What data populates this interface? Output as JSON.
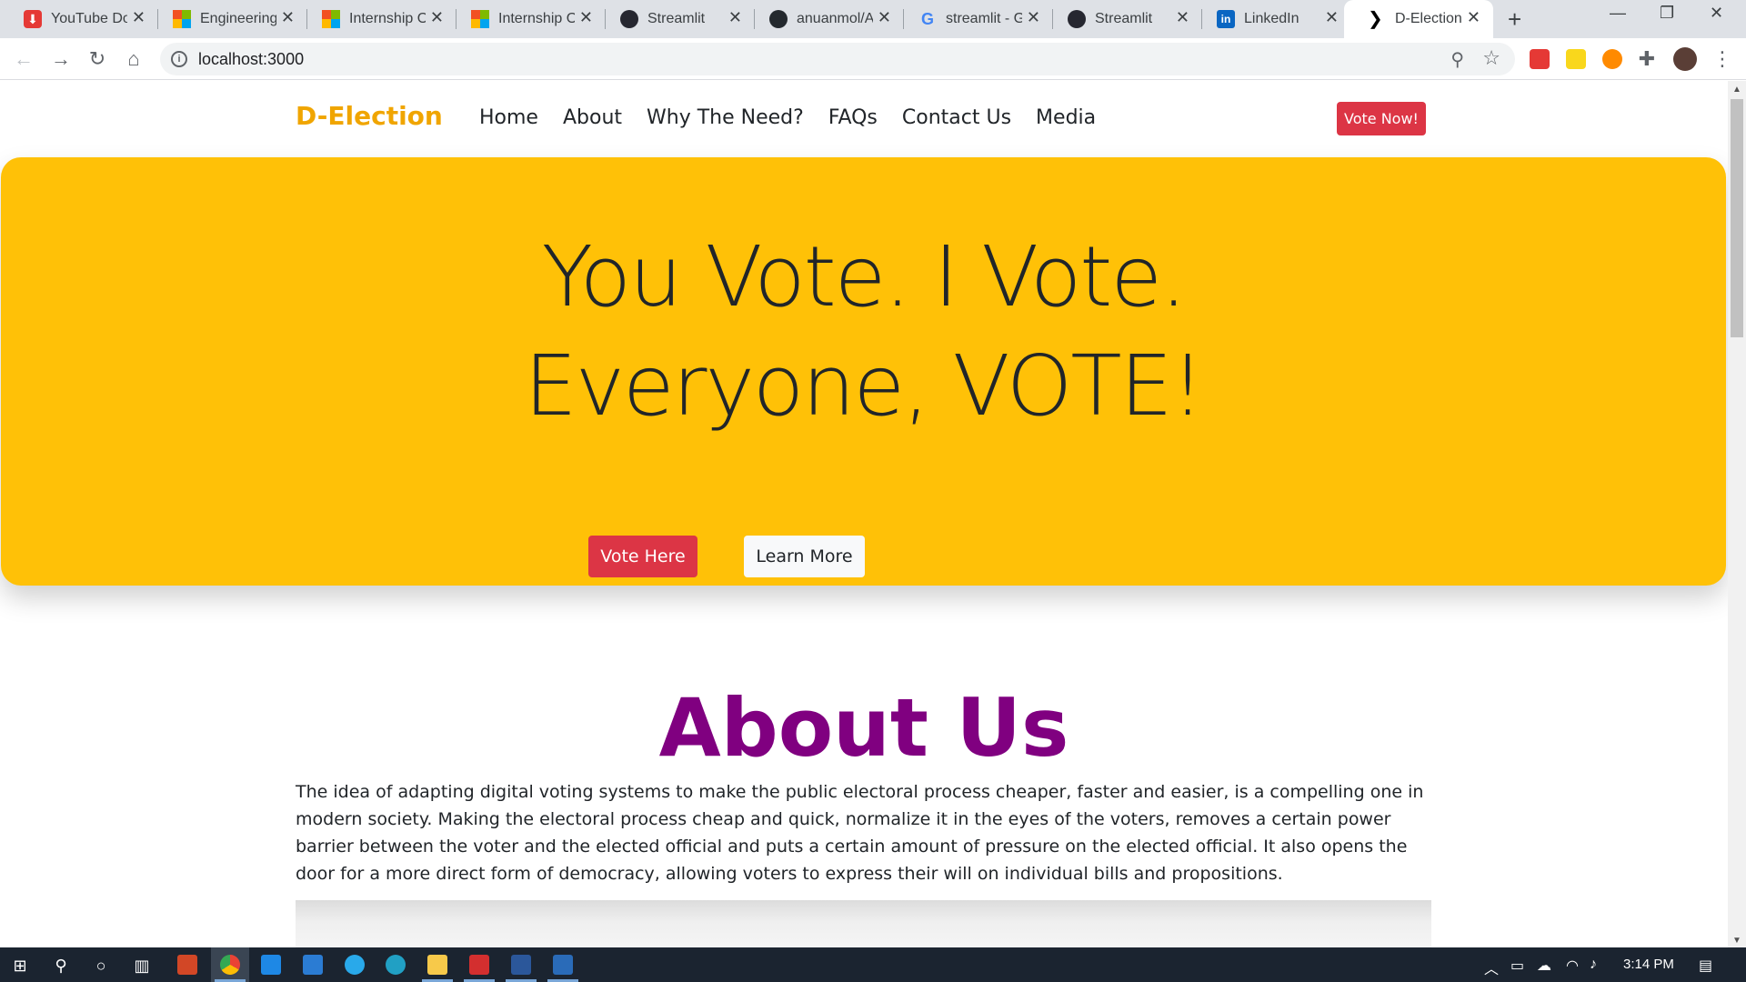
{
  "browser": {
    "tabs": [
      {
        "title": "YouTube Do",
        "favicon": "download-icon",
        "color": "#e53935"
      },
      {
        "title": "Engineering",
        "favicon": "microsoft-icon",
        "color": "#f25022"
      },
      {
        "title": "Internship O",
        "favicon": "microsoft-icon",
        "color": "#f25022"
      },
      {
        "title": "Internship O",
        "favicon": "microsoft-icon",
        "color": "#f25022"
      },
      {
        "title": "Streamlit",
        "favicon": "streamlit-icon",
        "color": "#262730"
      },
      {
        "title": "anuanmol/A",
        "favicon": "github-icon",
        "color": "#24292e"
      },
      {
        "title": "streamlit - G",
        "favicon": "google-icon",
        "color": "#4285f4"
      },
      {
        "title": "Streamlit",
        "favicon": "streamlit-icon",
        "color": "#262730"
      },
      {
        "title": "LinkedIn",
        "favicon": "linkedin-icon",
        "color": "#0a66c2"
      },
      {
        "title": "D-Election",
        "favicon": "chevron-logo-icon",
        "color": "#000000",
        "active": true
      }
    ],
    "url": "localhost:3000"
  },
  "site": {
    "brand": "D-Election",
    "nav": [
      "Home",
      "About",
      "Why The Need?",
      "FAQs",
      "Contact Us",
      "Media"
    ],
    "cta": "Vote Now!",
    "hero": {
      "line1": "You Vote. I Vote.",
      "line2": "Everyone, VOTE!",
      "primary_button": "Vote Here",
      "secondary_button": "Learn More"
    },
    "about": {
      "title": "About Us",
      "text": "The idea of adapting digital voting systems to make the public electoral process cheaper, faster and easier, is a compelling one in modern society. Making the electoral process cheap and quick, normalize it in the eyes of the voters, removes a certain power barrier between the voter and the elected official and puts a certain amount of pressure on the elected official. It also opens the door for a more direct form of democracy, allowing voters to express their will on individual bills and propositions."
    },
    "colors": {
      "brand": "#f0a500",
      "hero_bg": "#ffc107",
      "danger": "#dc3545",
      "about_title": "#800080"
    }
  },
  "taskbar": {
    "clock": "3:14 PM"
  }
}
